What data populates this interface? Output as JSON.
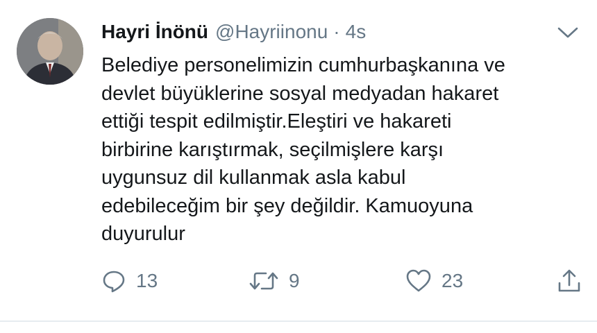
{
  "tweet": {
    "author": {
      "display_name": "Hayri İnönü",
      "handle": "@Hayriinonu",
      "avatar_icon": "profile-photo"
    },
    "separator": "·",
    "time": "4s",
    "text_lines": [
      "Belediye personelimizin cumhurbaşkanına ve",
      "devlet büyüklerine sosyal medyadan hakaret",
      "ettiği tespit edilmiştir.Eleştiri ve hakareti",
      "birbirine karıştırmak, seçilmişlere karşı",
      "uygunsuz dil kullanmak asla kabul",
      "edebileceğim bir şey değildir. Kamuoyuna",
      "duyurulur"
    ],
    "actions": {
      "reply": {
        "icon": "reply-icon",
        "count": "13"
      },
      "retweet": {
        "icon": "retweet-icon",
        "count": "9"
      },
      "like": {
        "icon": "heart-icon",
        "count": "23"
      },
      "share": {
        "icon": "share-icon"
      }
    },
    "menu_icon": "chevron-down-icon"
  },
  "colors": {
    "text": "#14171a",
    "secondary": "#657786",
    "divider": "#e6ecf0"
  }
}
